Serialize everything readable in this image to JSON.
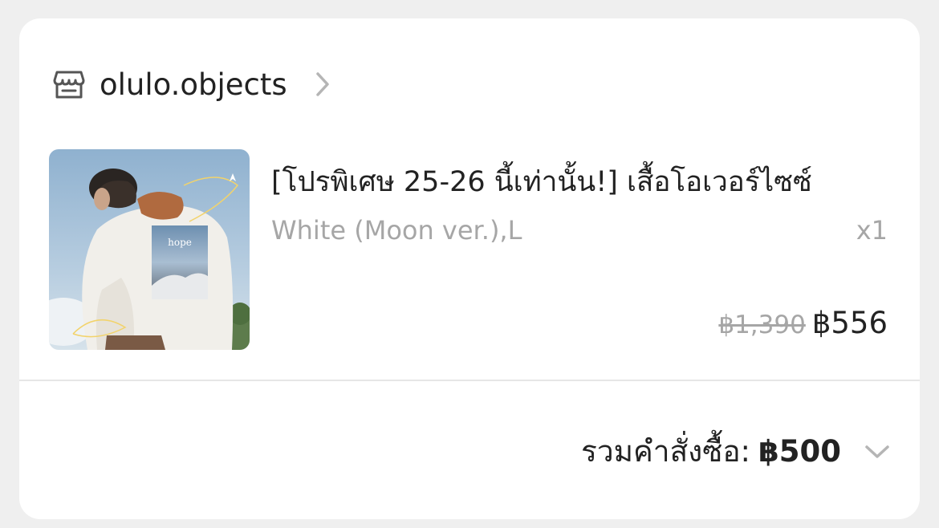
{
  "shop": {
    "name": "olulo.objects",
    "icon": "store-icon",
    "chevron_icon": "chevron-right-icon"
  },
  "item": {
    "title": "[โปรพิเศษ 25-26 นี้เท่านั้น!] เสื้อโอเวอร์ไซซ์",
    "variant": "White (Moon ver.),L",
    "quantity": "x1",
    "original_price": "฿1,390",
    "price": "฿556",
    "image_text": "hope",
    "image_alt": "product-photo"
  },
  "summary": {
    "label": "รวมคำสั่งซื้อ:",
    "total": "฿500",
    "expand_icon": "chevron-down-icon"
  },
  "colors": {
    "background": "#efefef",
    "card": "#ffffff",
    "text_primary": "#222222",
    "text_muted": "#a6a6a6",
    "divider": "#e6e6e6"
  }
}
